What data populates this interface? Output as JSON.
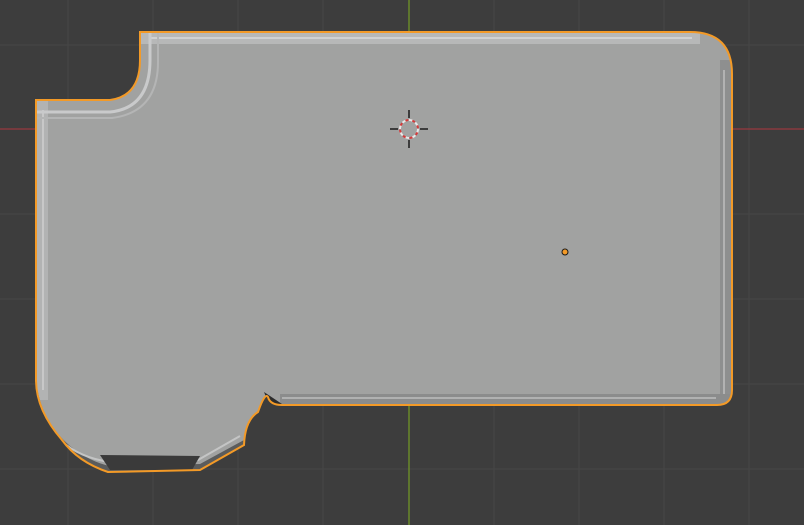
{
  "viewport": {
    "background_color": "#3d3d3d",
    "grid_line_color": "#474747",
    "x_axis_color": "#8a3a3f",
    "y_axis_color": "#6a8a2a"
  },
  "mesh_object": {
    "fill_color": "#a1a2a1",
    "bevel_highlight_color": "#c9cacb",
    "bevel_shadow_color": "#2c2c2c",
    "selection_outline_color": "#f39a27",
    "origin_color": "#f39a27"
  },
  "cursor_3d": {
    "ring_color_a": "#e8e8e8",
    "ring_color_b": "#d43b3b",
    "crosshair_color": "#1a1a1a"
  },
  "icons": {
    "cursor": "3d-cursor-icon",
    "origin": "object-origin-icon"
  }
}
